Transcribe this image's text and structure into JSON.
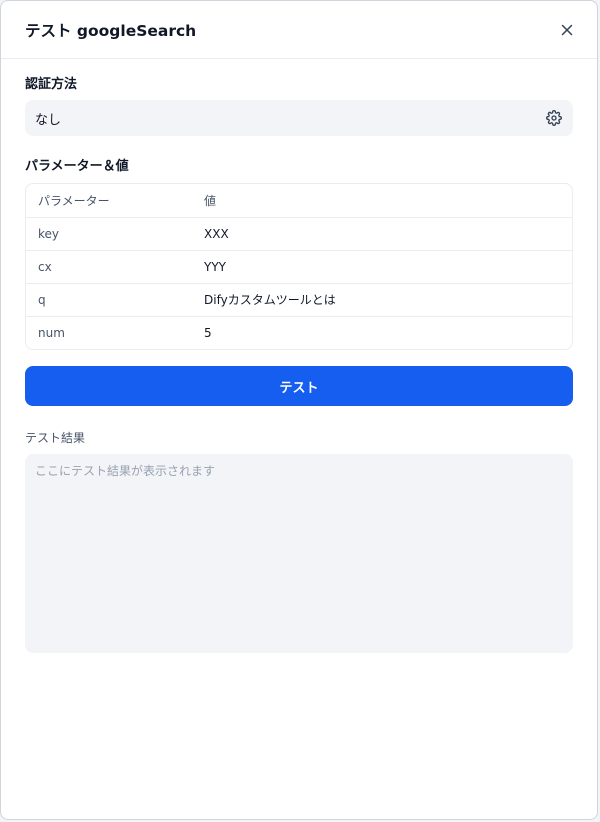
{
  "dialog": {
    "title": "テスト googleSearch",
    "close_icon": "close-icon"
  },
  "auth": {
    "label": "認証方法",
    "value": "なし",
    "settings_icon": "gear-icon"
  },
  "params": {
    "label": "パラメーター＆値",
    "header": {
      "name": "パラメーター",
      "value": "値"
    },
    "rows": [
      {
        "name": "key",
        "value": "XXX"
      },
      {
        "name": "cx",
        "value": "YYY"
      },
      {
        "name": "q",
        "value": "Difyカスタムツールとは"
      },
      {
        "name": "num",
        "value": "5"
      }
    ]
  },
  "actions": {
    "test_label": "テスト"
  },
  "result": {
    "label": "テスト結果",
    "placeholder": "ここにテスト結果が表示されます"
  },
  "colors": {
    "primary": "#155eef",
    "field_bg": "#f2f4f7",
    "border": "#eaecf0"
  }
}
